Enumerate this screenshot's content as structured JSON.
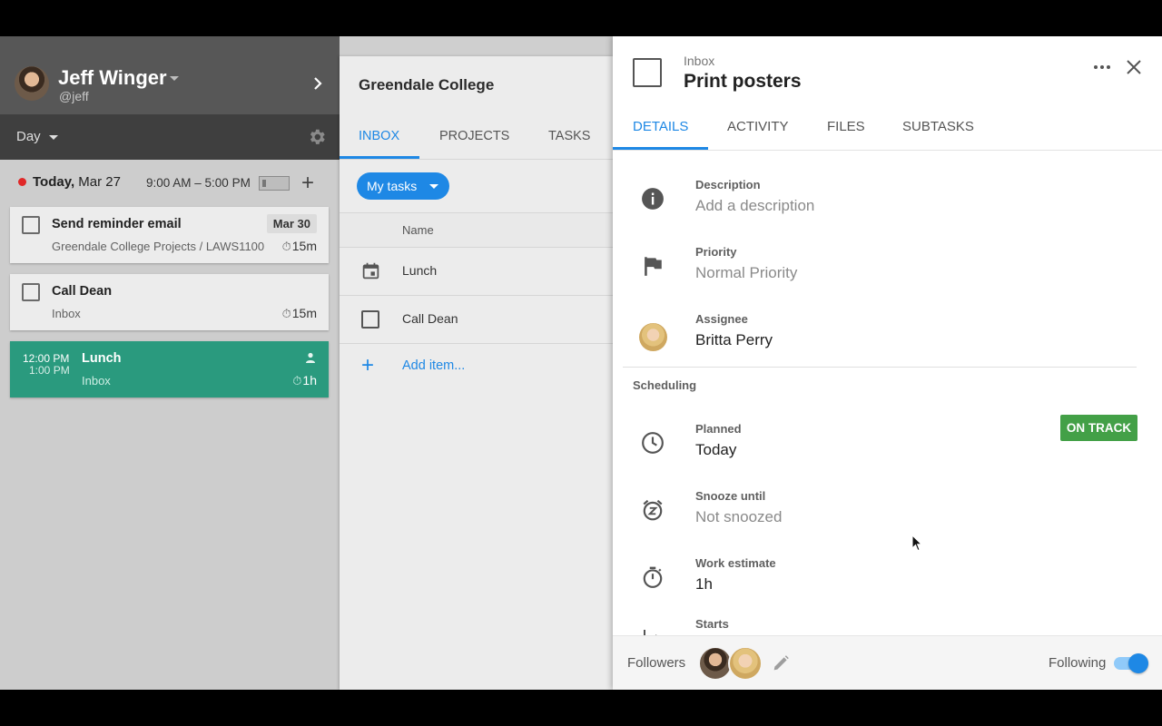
{
  "user": {
    "name": "Jeff Winger",
    "handle": "@jeff"
  },
  "planner": {
    "view": "Day",
    "today_prefix": "Today,",
    "today_date": "Mar 27",
    "work_hours": "9:00 AM – 5:00 PM",
    "tasks": [
      {
        "title": "Send reminder email",
        "due": "Mar 30",
        "project": "Greendale College Projects",
        "subproject": " / LAWS1100",
        "estimate": "15m"
      },
      {
        "title": "Call Dean",
        "project": "Inbox",
        "estimate": "15m"
      }
    ],
    "event": {
      "start": "12:00 PM",
      "end": "1:00 PM",
      "title": "Lunch",
      "project": "Inbox",
      "estimate": "1h"
    }
  },
  "project": {
    "title": "Greendale College",
    "tabs": [
      "INBOX",
      "PROJECTS",
      "TASKS"
    ],
    "active_tab": "INBOX",
    "filter": "My tasks",
    "column_name": "Name",
    "rows": [
      {
        "label": "Lunch",
        "icon": "calendar-icon"
      },
      {
        "label": "Call Dean",
        "icon": "checkbox"
      }
    ],
    "add_item": "Add item..."
  },
  "detail": {
    "parent": "Inbox",
    "title": "Print posters",
    "tabs": [
      "DETAILS",
      "ACTIVITY",
      "FILES",
      "SUBTASKS"
    ],
    "active_tab": "DETAILS",
    "description_label": "Description",
    "description_value": "Add a description",
    "priority_label": "Priority",
    "priority_value": "Normal Priority",
    "assignee_label": "Assignee",
    "assignee_value": "Britta Perry",
    "scheduling_title": "Scheduling",
    "planned_label": "Planned",
    "planned_value": "Today",
    "status": "ON TRACK",
    "snooze_label": "Snooze until",
    "snooze_value": "Not snoozed",
    "estimate_label": "Work estimate",
    "estimate_value": "1h",
    "starts_label": "Starts",
    "followers_label": "Followers",
    "following_label": "Following",
    "following_on": true
  },
  "colors": {
    "accent": "#1e88e5",
    "event": "#2a9a7e",
    "status_green": "#43a047",
    "today_dot": "#e02828"
  }
}
